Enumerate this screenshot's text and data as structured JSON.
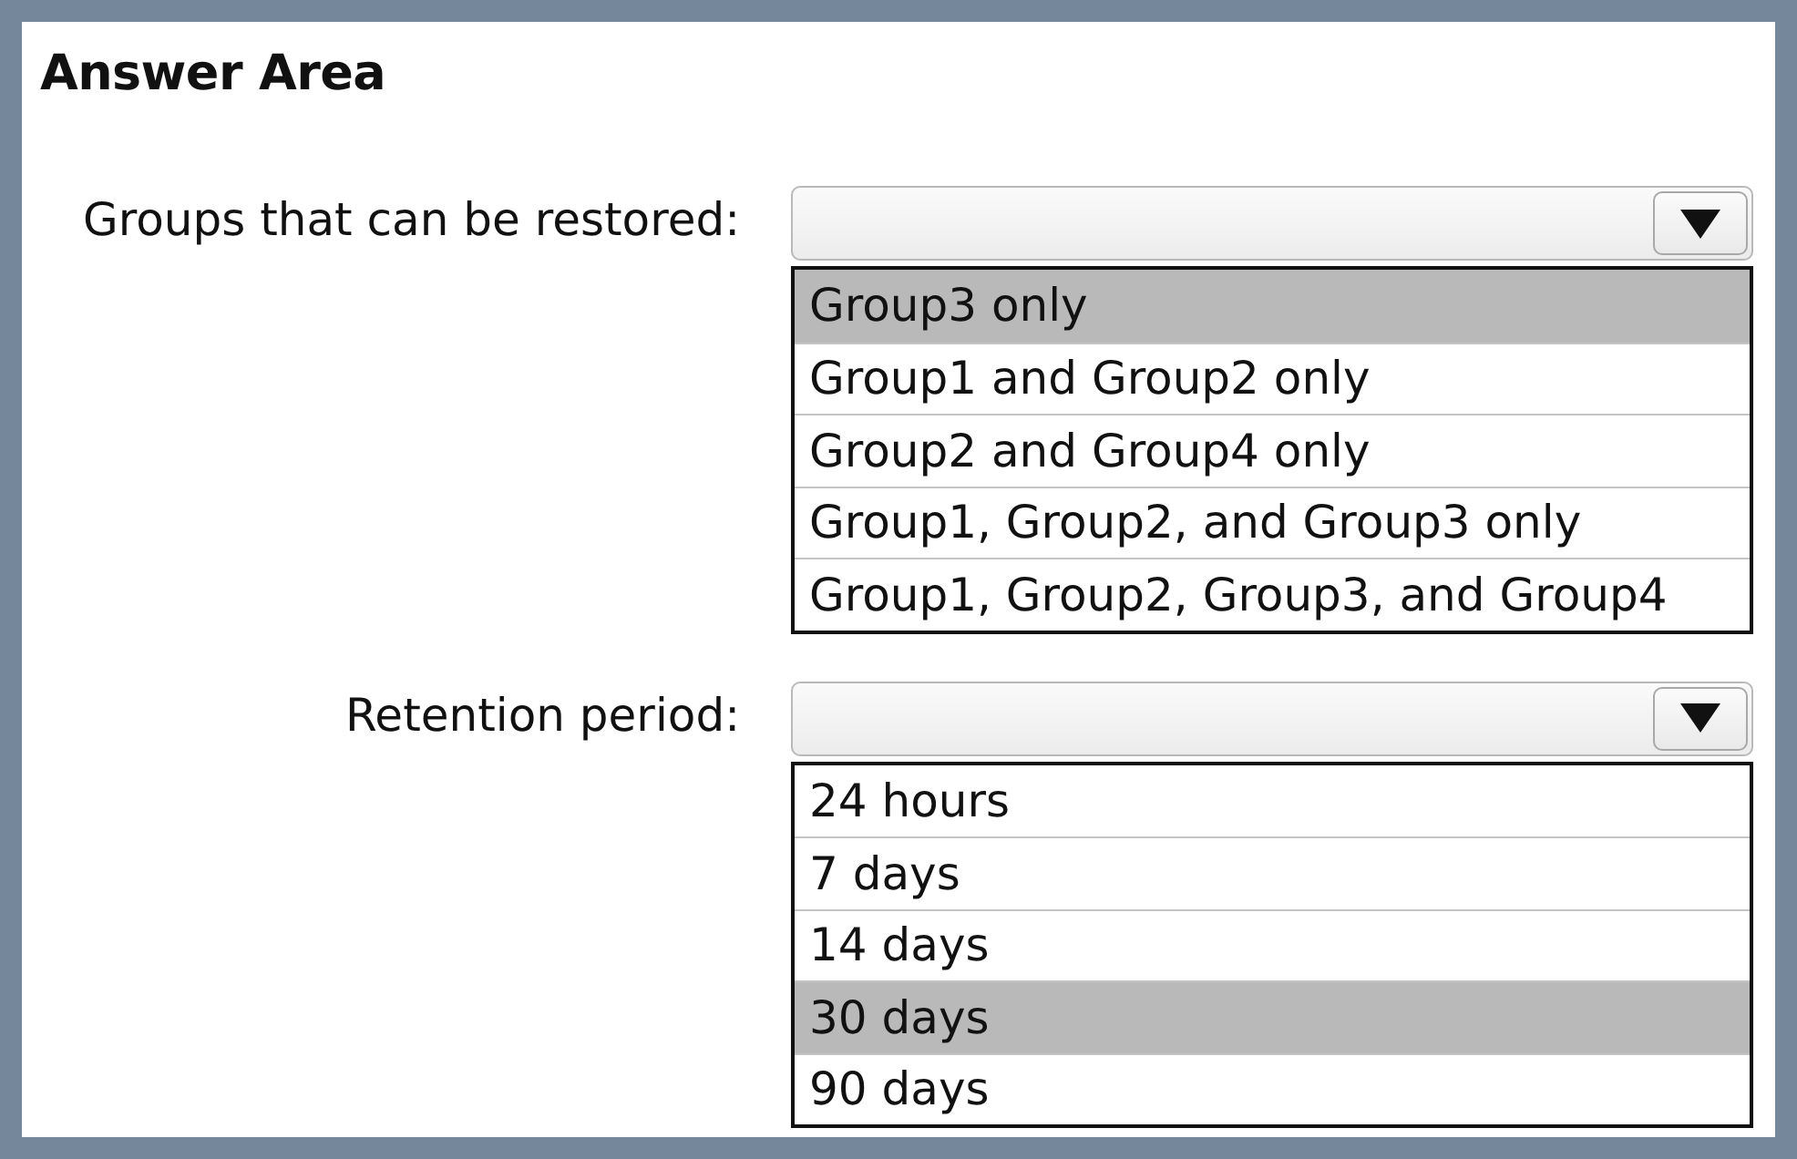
{
  "title": "Answer Area",
  "questions": [
    {
      "label": "Groups that can be restored:",
      "options": [
        {
          "text": "Group3 only",
          "selected": true
        },
        {
          "text": "Group1 and Group2 only",
          "selected": false
        },
        {
          "text": "Group2 and Group4 only",
          "selected": false
        },
        {
          "text": "Group1, Group2, and Group3 only",
          "selected": false
        },
        {
          "text": "Group1, Group2, Group3, and Group4",
          "selected": false
        }
      ]
    },
    {
      "label": "Retention period:",
      "options": [
        {
          "text": "24 hours",
          "selected": false
        },
        {
          "text": "7 days",
          "selected": false
        },
        {
          "text": "14 days",
          "selected": false
        },
        {
          "text": "30 days",
          "selected": true
        },
        {
          "text": "90 days",
          "selected": false
        }
      ]
    }
  ]
}
